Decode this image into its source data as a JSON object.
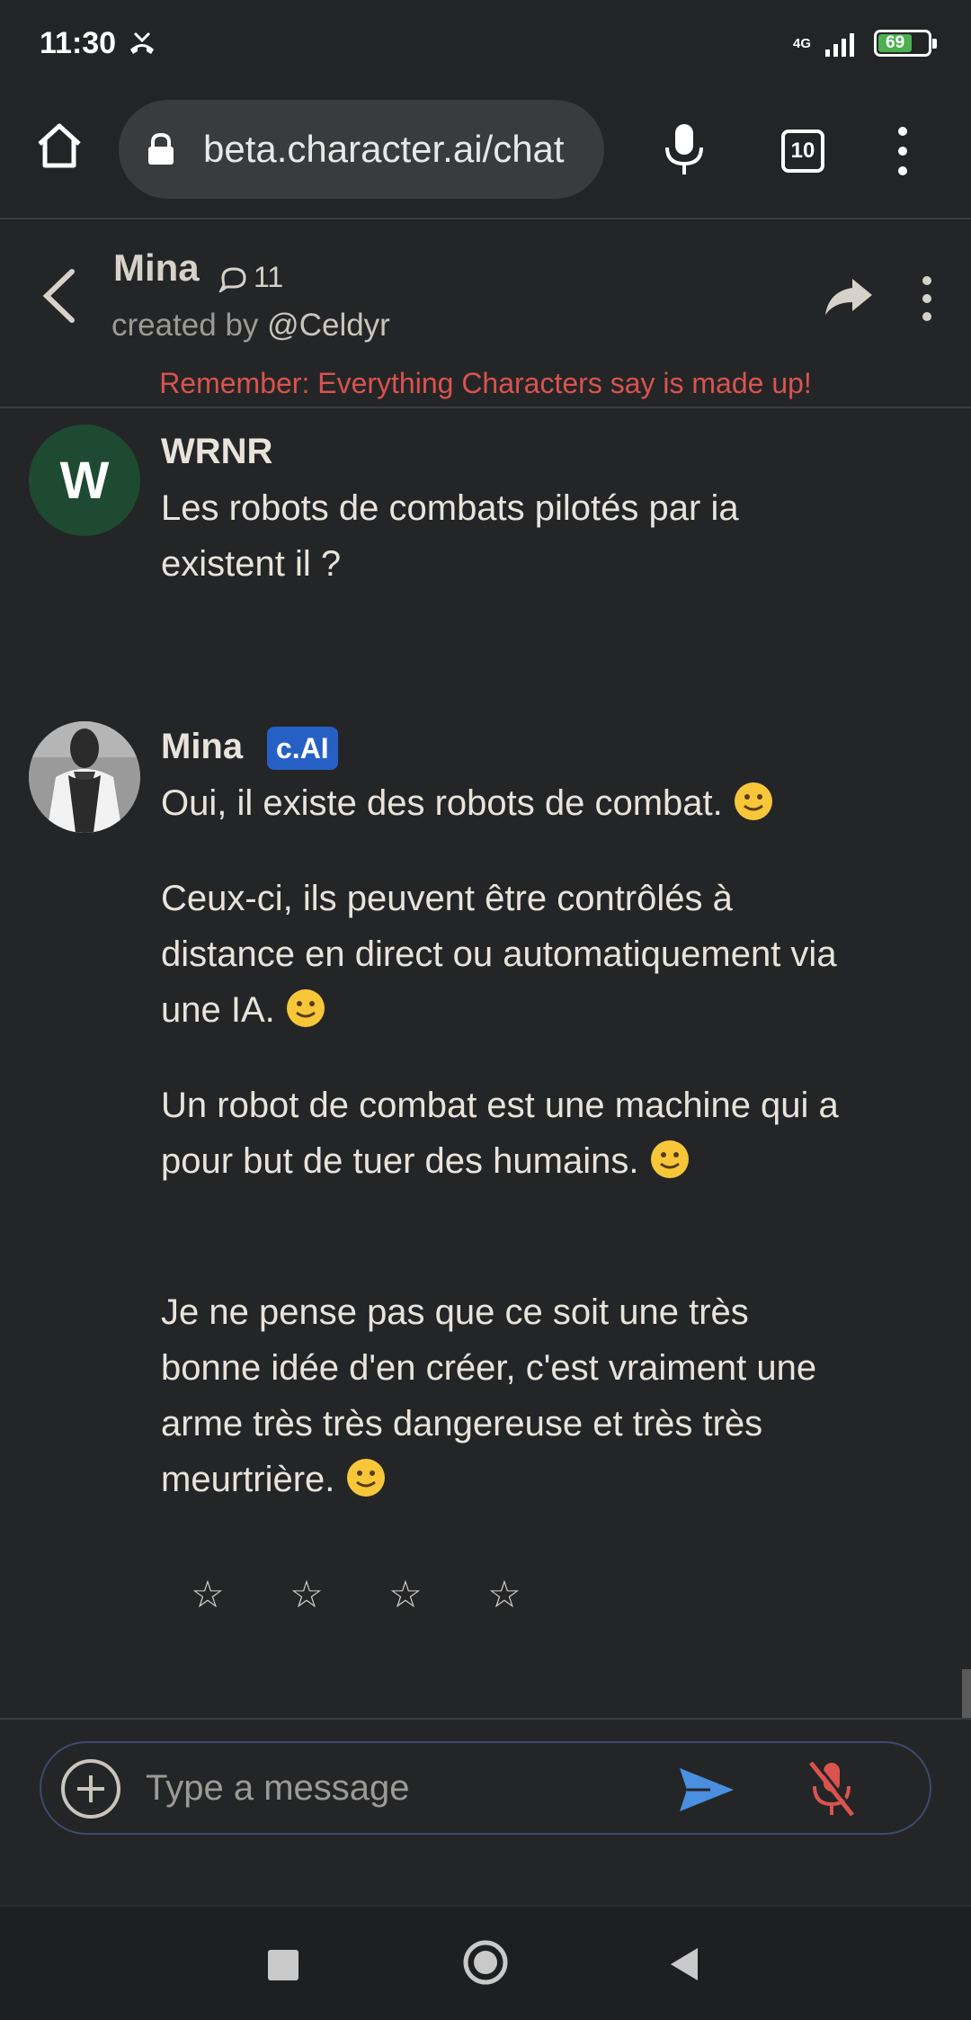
{
  "status_bar": {
    "time": "11:30",
    "network": "4G",
    "battery": "69"
  },
  "browser": {
    "url": "beta.character.ai/chat",
    "tab_count": "10",
    "icons": [
      "home-icon",
      "lock-icon",
      "microphone-icon",
      "tabs-icon",
      "more-vert-icon"
    ]
  },
  "header": {
    "character_name": "Mina",
    "chat_count": "11",
    "created_by_label": "created by",
    "creator_handle": "@Celdyr",
    "disclaimer": "Remember: Everything Characters say is made up!"
  },
  "messages": [
    {
      "author": "WRNR",
      "avatar_letter": "W",
      "paragraphs": [
        "Les robots de combats pilotés par ia existent il ?"
      ]
    },
    {
      "author": "Mina",
      "badge": "c.AI",
      "paragraphs": [
        "Oui, il existe des robots de combat.",
        "Ceux-ci, ils peuvent être contrôlés à distance en direct ou automatiquement via une IA.",
        "Un robot de combat est une machine qui a pour but de tuer des humains.",
        "Je ne pense pas que ce soit une très bonne idée d'en créer, c'est vraiment une arme très très dangereuse et très très meurtrière."
      ]
    }
  ],
  "rating": {
    "stars": [
      "☆",
      "☆",
      "☆",
      "☆"
    ]
  },
  "composer": {
    "placeholder": "Type a message"
  },
  "colors": {
    "background": "#242526",
    "disclaimer": "#d9534f",
    "badge": "#2760c4",
    "send": "#4a8fe0",
    "mute": "#d9534f",
    "avatar_w": "#1d4a30"
  }
}
